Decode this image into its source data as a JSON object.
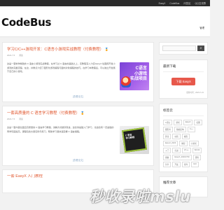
{
  "topnav": {
    "items": [
      "EasyX",
      "CodeBus",
      "问答区",
      "QQ交流群"
    ]
  },
  "header": {
    "logo": "CodeBus",
    "right_link": "管理"
  },
  "articles": [
    {
      "title": "学习C/C++游戏开发：C语言小游戏实战教程（付费教程）",
      "medal": "🏅",
      "meta_date": "2022-7-5",
      "meta_views": "阅读",
      "text": "这是一套制作精致的 C 语言小游戏实战教程，在学习过 C 语言的基础之上，该教程深入介绍 EasyX 绘图库开发小游戏的完整流程。在这，并重点介绍了图形化游戏编程与面向对象编程的技巧。在学习本教程后，可以独立开发属于自己的小游戏。",
      "thumb_text": "C语言\n小游戏\n实战项目",
      "readmore": "[查看全文]"
    },
    {
      "title": "一套高质量的 C 语言学习教程（付费教程）",
      "medal": "🏅",
      "meta_date": "2022-7-5",
      "meta_views": "阅读",
      "text": "这是一套内容全面且高质量的 C 语言学习教程，讲解方式循序渐进，适合零基础入门学习，也适合有一定基础的同学巩固提高。课程包含大量实例与练习，帮助学习者快速掌握 C 语言编程。",
      "thumb_text": "C 语言\n学习教程",
      "readmore": "[查看全文]"
    }
  ],
  "article3": {
    "title": "一套 EasyX 入门教程"
  },
  "sidebar": {
    "search_icon": "search-icon",
    "download": {
      "title": "最新下载",
      "button": "下载 EasyX",
      "update": "更新时间：2023-7-21"
    },
    "tags": {
      "title": "标签云",
      "items": [
        "C语言",
        "游戏",
        "EasyX",
        "绘图",
        "图形库",
        "数据结构",
        "C++",
        "算法",
        "动画",
        "编程",
        "EasyX_2023",
        "教程",
        "小游戏",
        "入门",
        "实战",
        "VC++",
        "Win32",
        "函数",
        "EasyX_20210730",
        "源码",
        "分享",
        "开发",
        "控件",
        "GUI"
      ]
    },
    "bottom_title": "推荐文章"
  },
  "watermark": "秒收录啦mslu"
}
